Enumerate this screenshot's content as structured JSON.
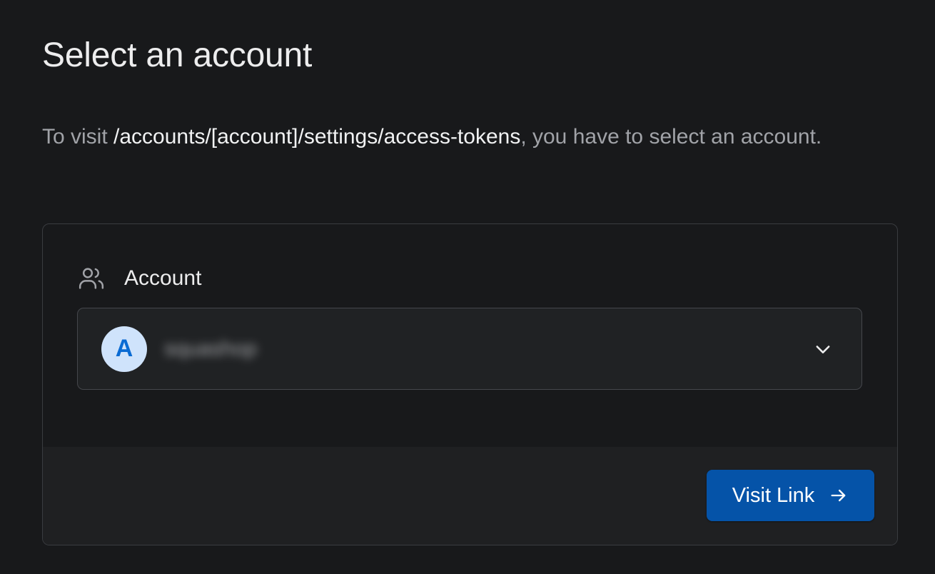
{
  "page": {
    "title": "Select an account",
    "description_prefix": "To visit ",
    "description_path": "/accounts/[account]/settings/access-tokens",
    "description_suffix": ", you have to select an account."
  },
  "form": {
    "field_label": "Account",
    "field_icon": "users-icon",
    "selected_account": {
      "avatar_letter": "A",
      "name": "squashop"
    },
    "dropdown_icon": "chevron-down-icon"
  },
  "footer": {
    "visit_button_label": "Visit Link",
    "visit_button_icon": "arrow-right-icon"
  },
  "colors": {
    "background": "#18191b",
    "primary_button": "#0553a8",
    "avatar_bg": "#cfe3fb",
    "avatar_text": "#0a6bd3"
  }
}
